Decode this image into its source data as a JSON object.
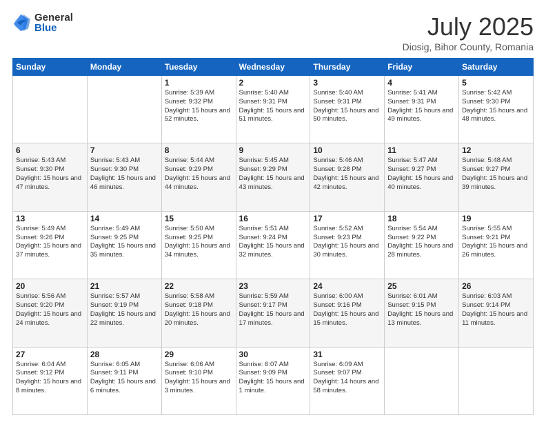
{
  "logo": {
    "general": "General",
    "blue": "Blue"
  },
  "header": {
    "month": "July 2025",
    "location": "Diosig, Bihor County, Romania"
  },
  "weekdays": [
    "Sunday",
    "Monday",
    "Tuesday",
    "Wednesday",
    "Thursday",
    "Friday",
    "Saturday"
  ],
  "weeks": [
    [
      {
        "day": "",
        "info": ""
      },
      {
        "day": "",
        "info": ""
      },
      {
        "day": "1",
        "info": "Sunrise: 5:39 AM\nSunset: 9:32 PM\nDaylight: 15 hours\nand 52 minutes."
      },
      {
        "day": "2",
        "info": "Sunrise: 5:40 AM\nSunset: 9:31 PM\nDaylight: 15 hours\nand 51 minutes."
      },
      {
        "day": "3",
        "info": "Sunrise: 5:40 AM\nSunset: 9:31 PM\nDaylight: 15 hours\nand 50 minutes."
      },
      {
        "day": "4",
        "info": "Sunrise: 5:41 AM\nSunset: 9:31 PM\nDaylight: 15 hours\nand 49 minutes."
      },
      {
        "day": "5",
        "info": "Sunrise: 5:42 AM\nSunset: 9:30 PM\nDaylight: 15 hours\nand 48 minutes."
      }
    ],
    [
      {
        "day": "6",
        "info": "Sunrise: 5:43 AM\nSunset: 9:30 PM\nDaylight: 15 hours\nand 47 minutes."
      },
      {
        "day": "7",
        "info": "Sunrise: 5:43 AM\nSunset: 9:30 PM\nDaylight: 15 hours\nand 46 minutes."
      },
      {
        "day": "8",
        "info": "Sunrise: 5:44 AM\nSunset: 9:29 PM\nDaylight: 15 hours\nand 44 minutes."
      },
      {
        "day": "9",
        "info": "Sunrise: 5:45 AM\nSunset: 9:29 PM\nDaylight: 15 hours\nand 43 minutes."
      },
      {
        "day": "10",
        "info": "Sunrise: 5:46 AM\nSunset: 9:28 PM\nDaylight: 15 hours\nand 42 minutes."
      },
      {
        "day": "11",
        "info": "Sunrise: 5:47 AM\nSunset: 9:27 PM\nDaylight: 15 hours\nand 40 minutes."
      },
      {
        "day": "12",
        "info": "Sunrise: 5:48 AM\nSunset: 9:27 PM\nDaylight: 15 hours\nand 39 minutes."
      }
    ],
    [
      {
        "day": "13",
        "info": "Sunrise: 5:49 AM\nSunset: 9:26 PM\nDaylight: 15 hours\nand 37 minutes."
      },
      {
        "day": "14",
        "info": "Sunrise: 5:49 AM\nSunset: 9:25 PM\nDaylight: 15 hours\nand 35 minutes."
      },
      {
        "day": "15",
        "info": "Sunrise: 5:50 AM\nSunset: 9:25 PM\nDaylight: 15 hours\nand 34 minutes."
      },
      {
        "day": "16",
        "info": "Sunrise: 5:51 AM\nSunset: 9:24 PM\nDaylight: 15 hours\nand 32 minutes."
      },
      {
        "day": "17",
        "info": "Sunrise: 5:52 AM\nSunset: 9:23 PM\nDaylight: 15 hours\nand 30 minutes."
      },
      {
        "day": "18",
        "info": "Sunrise: 5:54 AM\nSunset: 9:22 PM\nDaylight: 15 hours\nand 28 minutes."
      },
      {
        "day": "19",
        "info": "Sunrise: 5:55 AM\nSunset: 9:21 PM\nDaylight: 15 hours\nand 26 minutes."
      }
    ],
    [
      {
        "day": "20",
        "info": "Sunrise: 5:56 AM\nSunset: 9:20 PM\nDaylight: 15 hours\nand 24 minutes."
      },
      {
        "day": "21",
        "info": "Sunrise: 5:57 AM\nSunset: 9:19 PM\nDaylight: 15 hours\nand 22 minutes."
      },
      {
        "day": "22",
        "info": "Sunrise: 5:58 AM\nSunset: 9:18 PM\nDaylight: 15 hours\nand 20 minutes."
      },
      {
        "day": "23",
        "info": "Sunrise: 5:59 AM\nSunset: 9:17 PM\nDaylight: 15 hours\nand 17 minutes."
      },
      {
        "day": "24",
        "info": "Sunrise: 6:00 AM\nSunset: 9:16 PM\nDaylight: 15 hours\nand 15 minutes."
      },
      {
        "day": "25",
        "info": "Sunrise: 6:01 AM\nSunset: 9:15 PM\nDaylight: 15 hours\nand 13 minutes."
      },
      {
        "day": "26",
        "info": "Sunrise: 6:03 AM\nSunset: 9:14 PM\nDaylight: 15 hours\nand 11 minutes."
      }
    ],
    [
      {
        "day": "27",
        "info": "Sunrise: 6:04 AM\nSunset: 9:12 PM\nDaylight: 15 hours\nand 8 minutes."
      },
      {
        "day": "28",
        "info": "Sunrise: 6:05 AM\nSunset: 9:11 PM\nDaylight: 15 hours\nand 6 minutes."
      },
      {
        "day": "29",
        "info": "Sunrise: 6:06 AM\nSunset: 9:10 PM\nDaylight: 15 hours\nand 3 minutes."
      },
      {
        "day": "30",
        "info": "Sunrise: 6:07 AM\nSunset: 9:09 PM\nDaylight: 15 hours\nand 1 minute."
      },
      {
        "day": "31",
        "info": "Sunrise: 6:09 AM\nSunset: 9:07 PM\nDaylight: 14 hours\nand 58 minutes."
      },
      {
        "day": "",
        "info": ""
      },
      {
        "day": "",
        "info": ""
      }
    ]
  ]
}
